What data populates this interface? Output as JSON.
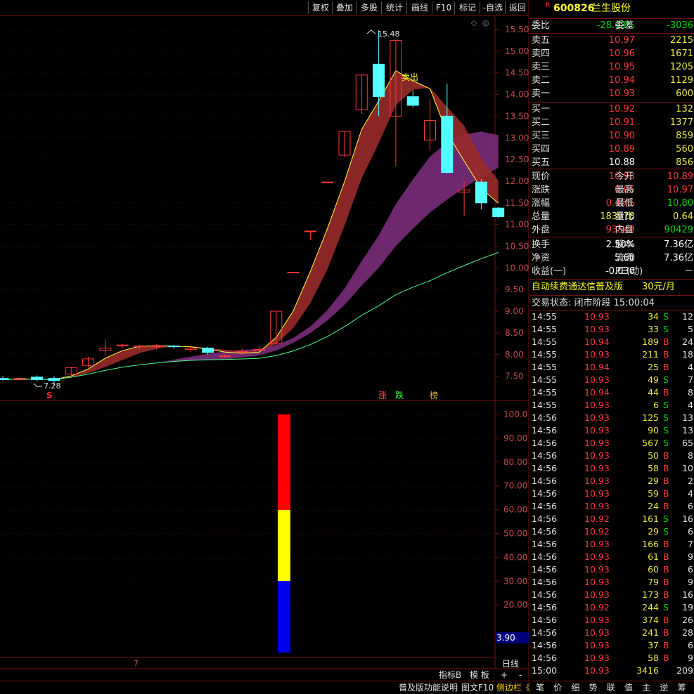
{
  "toolbar": {
    "buttons": [
      "复权",
      "叠加",
      "多股",
      "统计",
      "画线",
      "F10",
      "标记",
      "-自选",
      "返回"
    ]
  },
  "chart": {
    "price_ticks": [
      "15.50",
      "15.00",
      "14.50",
      "14.00",
      "13.50",
      "13.00",
      "12.50",
      "12.00",
      "11.50",
      "11.00",
      "10.50",
      "10.00",
      "9.50",
      "9.00",
      "8.50",
      "8.00",
      "7.50"
    ],
    "high_label": "15.48",
    "low_label": "7.28",
    "sell_label": "卖出",
    "markers": {
      "s": "S",
      "zhang": "涨",
      "die": "跌",
      "bang": "榜"
    },
    "indicator_ticks": [
      "100.0",
      "90.00",
      "80.00",
      "70.00",
      "60.00",
      "50.00",
      "40.00",
      "30.00",
      "20.00"
    ],
    "indicator_value": "3.90",
    "x_tick_label": "7",
    "period": "日线",
    "sub_buttons": [
      "指标B",
      "模 板",
      "+",
      "-"
    ],
    "candles": [
      {
        "o": 7.45,
        "c": 7.42,
        "h": 7.5,
        "l": 7.4
      },
      {
        "o": 7.42,
        "c": 7.45,
        "h": 7.48,
        "l": 7.4
      },
      {
        "o": 7.48,
        "c": 7.42,
        "h": 7.52,
        "l": 7.38
      },
      {
        "o": 7.45,
        "c": 7.4,
        "h": 7.5,
        "l": 7.28
      },
      {
        "o": 7.55,
        "c": 7.7,
        "h": 7.72,
        "l": 7.5
      },
      {
        "o": 7.75,
        "c": 7.9,
        "h": 7.95,
        "l": 7.7
      },
      {
        "o": 8.1,
        "c": 8.15,
        "h": 8.35,
        "l": 8.0
      },
      {
        "o": 8.2,
        "c": 8.22,
        "h": 8.25,
        "l": 8.15
      },
      {
        "o": 8.18,
        "c": 8.2,
        "h": 8.22,
        "l": 8.12
      },
      {
        "o": 8.18,
        "c": 8.2,
        "h": 8.24,
        "l": 8.12
      },
      {
        "o": 8.2,
        "c": 8.18,
        "h": 8.22,
        "l": 8.14
      },
      {
        "o": 8.12,
        "c": 8.15,
        "h": 8.18,
        "l": 8.05
      },
      {
        "o": 8.15,
        "c": 8.05,
        "h": 8.18,
        "l": 8.0
      },
      {
        "o": 7.95,
        "c": 7.97,
        "h": 8.0,
        "l": 7.92
      },
      {
        "o": 8.05,
        "c": 8.07,
        "h": 8.15,
        "l": 8.0
      },
      {
        "o": 8.1,
        "c": 8.12,
        "h": 8.2,
        "l": 8.08
      },
      {
        "o": 8.25,
        "c": 9.0,
        "h": 9.0,
        "l": 8.2
      },
      {
        "o": 9.9,
        "c": 9.9,
        "h": 9.9,
        "l": 9.9
      },
      {
        "o": 10.85,
        "c": 10.85,
        "h": 10.85,
        "l": 10.65
      },
      {
        "o": 11.98,
        "c": 11.98,
        "h": 11.98,
        "l": 11.98
      },
      {
        "o": 12.6,
        "c": 13.15,
        "h": 13.15,
        "l": 12.55
      },
      {
        "o": 13.65,
        "c": 14.45,
        "h": 14.45,
        "l": 13.55
      },
      {
        "o": 14.7,
        "c": 13.95,
        "h": 15.48,
        "l": 13.5
      },
      {
        "o": 13.5,
        "c": 15.25,
        "h": 15.25,
        "l": 12.35
      },
      {
        "o": 13.95,
        "c": 13.75,
        "h": 14.1,
        "l": 13.7
      },
      {
        "o": 12.95,
        "c": 13.4,
        "h": 13.9,
        "l": 12.7
      },
      {
        "o": 13.5,
        "c": 12.2,
        "h": 14.25,
        "l": 12.2
      },
      {
        "o": 11.75,
        "c": 11.8,
        "h": 12.0,
        "l": 11.2
      },
      {
        "o": 11.98,
        "c": 11.5,
        "h": 12.05,
        "l": 11.35
      },
      {
        "o": 11.38,
        "c": 11.18,
        "h": 11.4,
        "l": 11.15
      }
    ]
  },
  "quote": {
    "badge": "R",
    "code": "600826",
    "name": "兰生股份",
    "webi_label": "委比",
    "webi": "-28.63%",
    "wecha_label": "委差",
    "wecha": "-3036",
    "asks": [
      {
        "label": "卖五",
        "price": "10.97",
        "vol": "2215"
      },
      {
        "label": "卖四",
        "price": "10.96",
        "vol": "1671"
      },
      {
        "label": "卖三",
        "price": "10.95",
        "vol": "1205"
      },
      {
        "label": "卖二",
        "price": "10.94",
        "vol": "1129"
      },
      {
        "label": "卖一",
        "price": "10.93",
        "vol": "600"
      }
    ],
    "bids": [
      {
        "label": "买一",
        "price": "10.92",
        "vol": "132"
      },
      {
        "label": "买二",
        "price": "10.91",
        "vol": "1377"
      },
      {
        "label": "买三",
        "price": "10.90",
        "vol": "859"
      },
      {
        "label": "买四",
        "price": "10.89",
        "vol": "560"
      },
      {
        "label": "买五",
        "price": "10.88",
        "vol": "856"
      }
    ],
    "stats": [
      {
        "l1": "现价",
        "v1": "10.93",
        "c1": "red",
        "l2": "今开",
        "v2": "10.89",
        "c2": "red"
      },
      {
        "l1": "涨跌",
        "v1": "0.05",
        "c1": "red",
        "l2": "最高",
        "v2": "10.97",
        "c2": "red"
      },
      {
        "l1": "涨幅",
        "v1": "0.46%",
        "c1": "red",
        "l2": "最低",
        "v2": "10.80",
        "c2": "grn"
      },
      {
        "l1": "总量",
        "v1": "183978",
        "c1": "yel",
        "l2": "量比",
        "v2": "0.64",
        "c2": "yel"
      },
      {
        "l1": "外盘",
        "v1": "93549",
        "c1": "red",
        "l2": "内盘",
        "v2": "90429",
        "c2": "grn"
      }
    ],
    "stats2": [
      {
        "l1": "换手",
        "v1": "2.50%",
        "l2": "股本",
        "v2": "7.36亿"
      },
      {
        "l1": "净资",
        "v1": "5.60",
        "l2": "流通",
        "v2": "7.36亿"
      },
      {
        "l1": "收益(一)",
        "v1": "-0.030",
        "l2": "PE(动)",
        "v2": "－"
      }
    ],
    "promo": "自动续费通达信普及版",
    "promo_price": "30元/月",
    "trade_status": "交易状态: 闭市阶段 15:00:04"
  },
  "trades": [
    {
      "t": "14:55",
      "p": "10.93",
      "v": "34",
      "bs": "S",
      "n": "12"
    },
    {
      "t": "14:55",
      "p": "10.93",
      "v": "33",
      "bs": "S",
      "n": "5"
    },
    {
      "t": "14:55",
      "p": "10.94",
      "v": "189",
      "bs": "B",
      "n": "24"
    },
    {
      "t": "14:55",
      "p": "10.93",
      "v": "211",
      "bs": "B",
      "n": "18"
    },
    {
      "t": "14:55",
      "p": "10.94",
      "v": "25",
      "bs": "B",
      "n": "4"
    },
    {
      "t": "14:55",
      "p": "10.93",
      "v": "49",
      "bs": "S",
      "n": "7"
    },
    {
      "t": "14:55",
      "p": "10.94",
      "v": "44",
      "bs": "B",
      "n": "8"
    },
    {
      "t": "14:55",
      "p": "10.93",
      "v": "6",
      "bs": "S",
      "n": "4"
    },
    {
      "t": "14:56",
      "p": "10.93",
      "v": "125",
      "bs": "S",
      "n": "13"
    },
    {
      "t": "14:56",
      "p": "10.93",
      "v": "90",
      "bs": "S",
      "n": "13"
    },
    {
      "t": "14:56",
      "p": "10.93",
      "v": "567",
      "bs": "S",
      "n": "65"
    },
    {
      "t": "14:56",
      "p": "10.93",
      "v": "50",
      "bs": "B",
      "n": "8"
    },
    {
      "t": "14:56",
      "p": "10.93",
      "v": "58",
      "bs": "B",
      "n": "10"
    },
    {
      "t": "14:56",
      "p": "10.93",
      "v": "29",
      "bs": "B",
      "n": "2"
    },
    {
      "t": "14:56",
      "p": "10.93",
      "v": "59",
      "bs": "B",
      "n": "4"
    },
    {
      "t": "14:56",
      "p": "10.93",
      "v": "24",
      "bs": "B",
      "n": "6"
    },
    {
      "t": "14:56",
      "p": "10.92",
      "v": "161",
      "bs": "S",
      "n": "16"
    },
    {
      "t": "14:56",
      "p": "10.92",
      "v": "29",
      "bs": "S",
      "n": "6"
    },
    {
      "t": "14:56",
      "p": "10.93",
      "v": "166",
      "bs": "B",
      "n": "7"
    },
    {
      "t": "14:56",
      "p": "10.93",
      "v": "61",
      "bs": "B",
      "n": "9"
    },
    {
      "t": "14:56",
      "p": "10.93",
      "v": "60",
      "bs": "B",
      "n": "6"
    },
    {
      "t": "14:56",
      "p": "10.93",
      "v": "79",
      "bs": "B",
      "n": "9"
    },
    {
      "t": "14:56",
      "p": "10.93",
      "v": "173",
      "bs": "B",
      "n": "16"
    },
    {
      "t": "14:56",
      "p": "10.92",
      "v": "244",
      "bs": "S",
      "n": "19"
    },
    {
      "t": "14:56",
      "p": "10.93",
      "v": "374",
      "bs": "B",
      "n": "26"
    },
    {
      "t": "14:56",
      "p": "10.93",
      "v": "241",
      "bs": "B",
      "n": "28"
    },
    {
      "t": "14:56",
      "p": "10.93",
      "v": "37",
      "bs": "B",
      "n": "6"
    },
    {
      "t": "14:56",
      "p": "10.93",
      "v": "58",
      "bs": "B",
      "n": "9"
    },
    {
      "t": "15:00",
      "p": "10.93",
      "v": "3416",
      "bs": "",
      "n": "209"
    }
  ],
  "bottombar": {
    "left": [
      "普及版功能说明",
      "图文F10",
      "侧边栏《"
    ],
    "tabs": [
      "笔",
      "价",
      "细",
      "势",
      "联",
      "值",
      "主",
      "逆",
      "筹"
    ]
  },
  "colors": {
    "up": "#ff3838",
    "down": "#54ffff",
    "ask": "#ff3838",
    "bid": "#00d600",
    "vol": "#e8e84a"
  }
}
